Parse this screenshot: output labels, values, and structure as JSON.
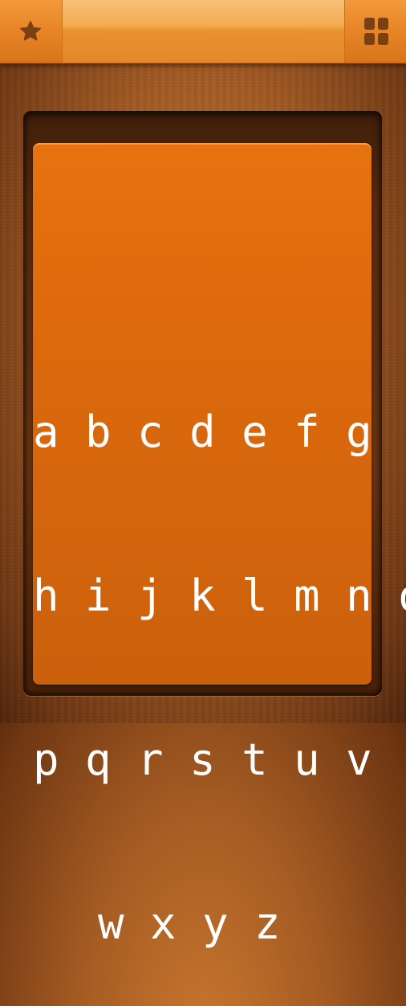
{
  "toolbar": {
    "left_icon": "star-icon",
    "right_icon": "grid-icon",
    "title": ""
  },
  "card": {
    "rows": [
      "a b c d e f g",
      "h i j k l m n o",
      "p q r s t u v",
      "w x y z "
    ]
  },
  "colors": {
    "toolbar_orange": "#e88628",
    "card_orange": "#de6a0c",
    "wood": "#a35a22",
    "icon_brown": "#7a3f12",
    "text": "#ffffff"
  }
}
